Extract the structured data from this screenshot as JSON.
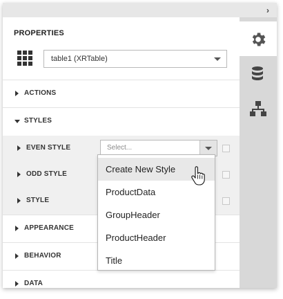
{
  "header": {
    "collapse_glyph": "›",
    "title": "PROPERTIES"
  },
  "component_selector": {
    "icon": "grid-icon",
    "value": "table1 (XRTable)"
  },
  "sidebar_tabs": [
    {
      "icon": "gear-icon",
      "active": true
    },
    {
      "icon": "database-icon",
      "active": false
    },
    {
      "icon": "hierarchy-icon",
      "active": false
    }
  ],
  "sections": {
    "actions": "ACTIONS",
    "styles": "STYLES",
    "appearance": "APPEARANCE",
    "behavior": "BEHAVIOR",
    "data": "DATA"
  },
  "style_rows": [
    {
      "label": "EVEN STYLE"
    },
    {
      "label": "ODD STYLE"
    },
    {
      "label": "STYLE"
    }
  ],
  "even_style_select": {
    "placeholder": "Select..."
  },
  "dropdown_items": [
    "Create New Style",
    "ProductData",
    "GroupHeader",
    "ProductHeader",
    "Title"
  ],
  "colors": {
    "sidebar_bg": "#d8d8d8",
    "panel_bg": "#ffffff",
    "styles_body_bg": "#f0f0f0",
    "hover_bg": "#e8e8e8"
  }
}
